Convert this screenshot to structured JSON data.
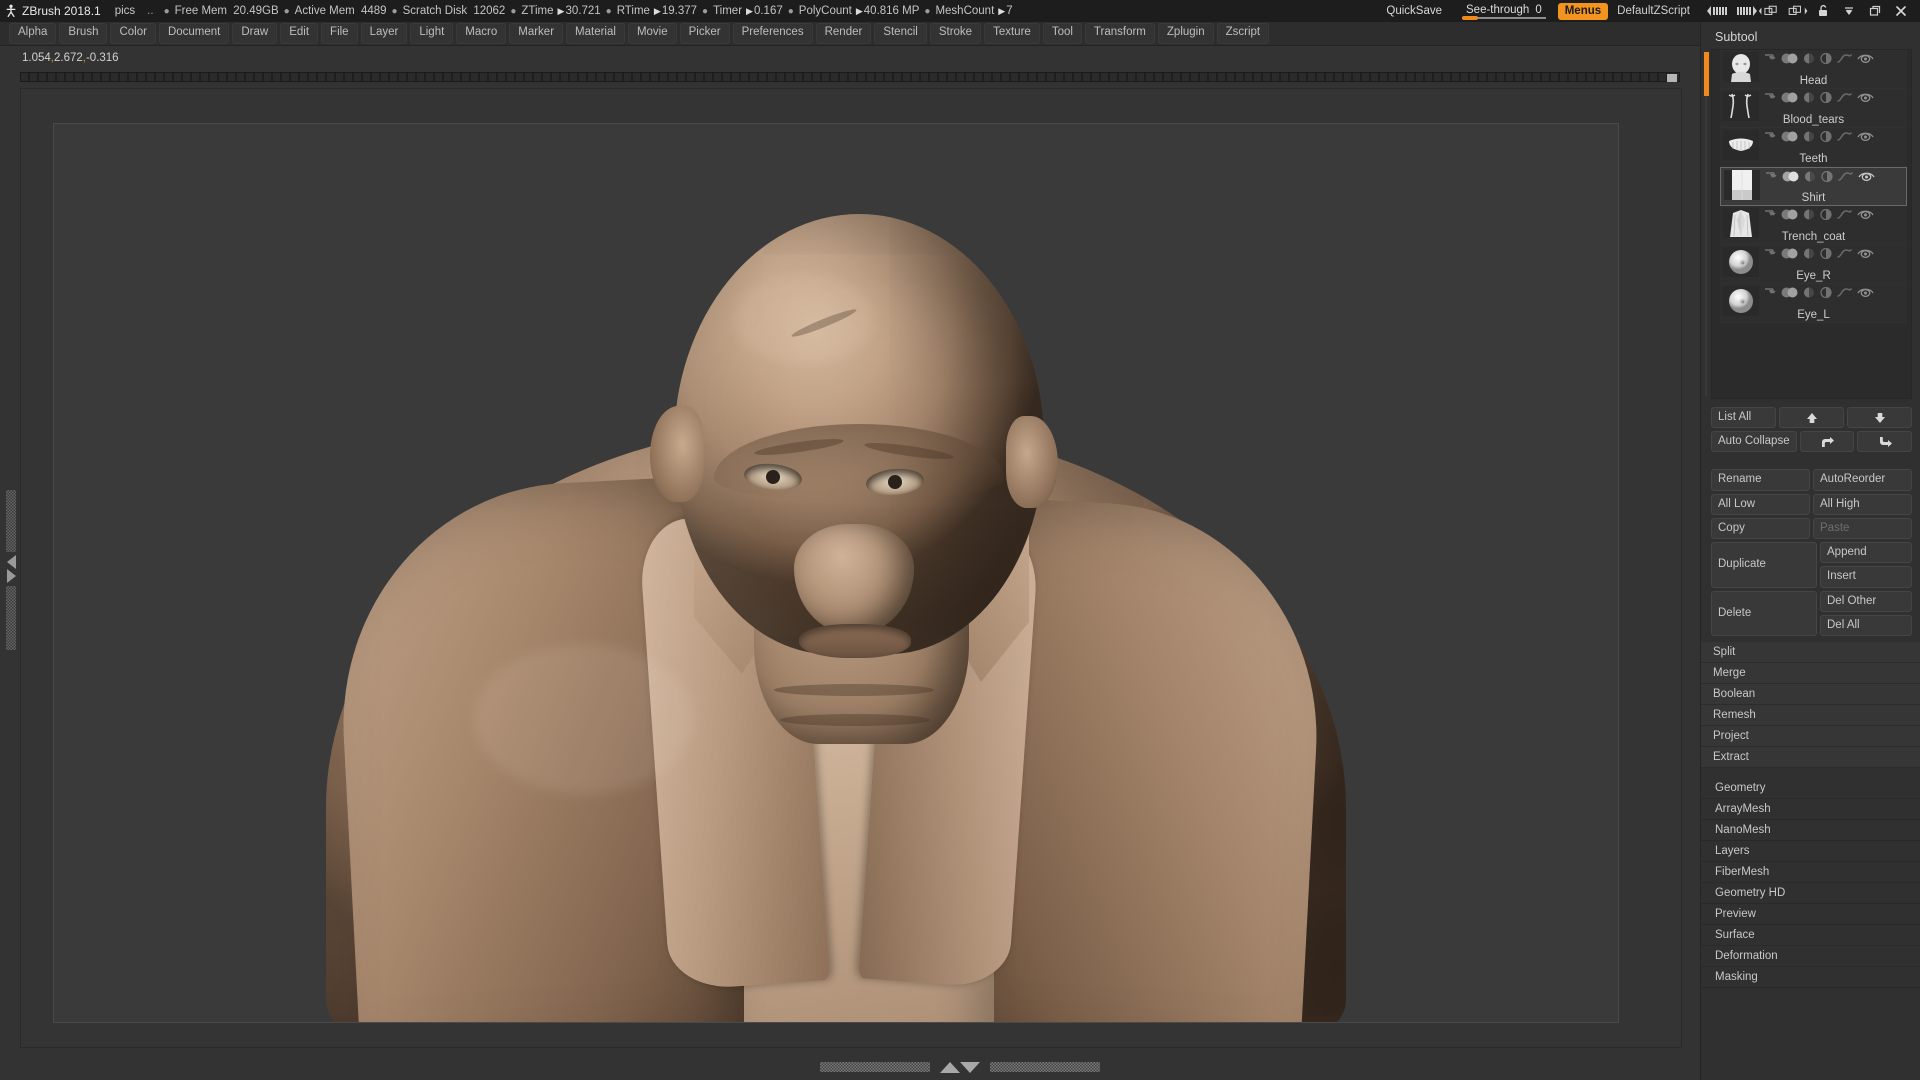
{
  "titlebar": {
    "logo_icon": "zbrush-logo-icon",
    "app": "ZBrush 2018.1",
    "document": "pics",
    "dots": "..",
    "stats": [
      {
        "label": "Free Mem",
        "value": "20.49GB",
        "arrow": false
      },
      {
        "label": "Active Mem",
        "value": "4489",
        "arrow": false
      },
      {
        "label": "Scratch Disk",
        "value": "12062",
        "arrow": false
      },
      {
        "label": "ZTime",
        "value": "30.721",
        "arrow": true
      },
      {
        "label": "RTime",
        "value": "19.377",
        "arrow": true
      },
      {
        "label": "Timer",
        "value": "0.167",
        "arrow": true
      },
      {
        "label": "PolyCount",
        "value": "40.816 MP",
        "arrow": true
      },
      {
        "label": "MeshCount",
        "value": "7",
        "arrow": true
      }
    ],
    "quicksave": "QuickSave",
    "see_through_label": "See-through",
    "see_through_value": "0",
    "menus": "Menus",
    "zscript": "DefaultZScript",
    "accent": "#f2941f"
  },
  "menubar": {
    "items": [
      "Alpha",
      "Brush",
      "Color",
      "Document",
      "Draw",
      "Edit",
      "File",
      "Layer",
      "Light",
      "Macro",
      "Marker",
      "Material",
      "Movie",
      "Picker",
      "Preferences",
      "Render",
      "Stencil",
      "Stroke",
      "Texture",
      "Tool",
      "Transform",
      "Zplugin",
      "Zscript"
    ]
  },
  "canvas": {
    "coordinates": "1.054,2.672,-0.316",
    "coord_x": "1.054",
    "coord_y": "2.672",
    "coord_z": "-0.316"
  },
  "subtool_panel": {
    "title": "Subtool",
    "items": [
      {
        "name": "Head",
        "selected": false,
        "thumb": "head-thumb"
      },
      {
        "name": "Blood_tears",
        "selected": false,
        "thumb": "blood-tears-thumb"
      },
      {
        "name": "Teeth",
        "selected": false,
        "thumb": "teeth-thumb"
      },
      {
        "name": "Shirt",
        "selected": true,
        "thumb": "shirt-thumb"
      },
      {
        "name": "Trench_coat",
        "selected": false,
        "thumb": "trench-coat-thumb"
      },
      {
        "name": "Eye_R",
        "selected": false,
        "thumb": "eye-r-thumb"
      },
      {
        "name": "Eye_L",
        "selected": false,
        "thumb": "eye-l-thumb"
      }
    ],
    "row_icons": [
      "arrow-down-icon",
      "visibility-circles-icon",
      "half-circle-icon",
      "contrast-circle-icon",
      "brush-stroke-icon",
      "eye-icon"
    ],
    "buttons": {
      "list_all": "List All",
      "auto_collapse": "Auto Collapse",
      "move_up": "▲",
      "move_down": "▼",
      "move_in": "⤷",
      "move_out": "↳",
      "rename": "Rename",
      "auto_reorder": "AutoReorder",
      "all_low": "All Low",
      "all_high": "All High",
      "copy": "Copy",
      "paste": "Paste",
      "duplicate": "Duplicate",
      "append": "Append",
      "insert": "Insert",
      "delete": "Delete",
      "del_other": "Del Other",
      "del_all": "Del All"
    },
    "operations": [
      "Split",
      "Merge",
      "Boolean",
      "Remesh",
      "Project",
      "Extract"
    ]
  },
  "tool_menu": {
    "items": [
      "Geometry",
      "ArrayMesh",
      "NanoMesh",
      "Layers",
      "FiberMesh",
      "Geometry HD",
      "Preview",
      "Surface",
      "Deformation",
      "Masking"
    ]
  }
}
